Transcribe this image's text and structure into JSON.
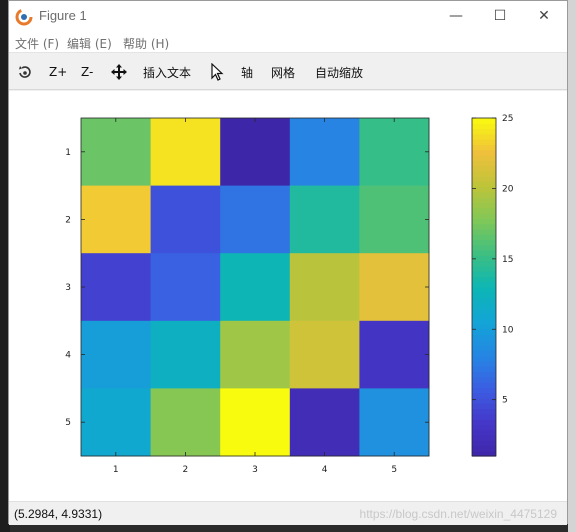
{
  "window": {
    "title": "Figure 1",
    "minimize_glyph": "—",
    "maximize_glyph": "☐",
    "close_glyph": "✕"
  },
  "menu": {
    "items": [
      {
        "label": "文件 (F)"
      },
      {
        "label": "编辑 (E)"
      },
      {
        "label": "帮助 (H)"
      }
    ]
  },
  "toolbar": {
    "zoom_in_label": "Z+",
    "zoom_out_label": "Z-",
    "insert_text_label": "插入文本",
    "axis_label": "轴",
    "grid_label": "网格",
    "auto_zoom_label": "自动缩放",
    "icons": [
      "rotate-icon",
      "pan-icon",
      "pointer-icon"
    ]
  },
  "statusbar": {
    "coordinates": "(5.2984, 4.9331)",
    "watermark": "https://blog.csdn.net/weixin_4475129"
  },
  "chart_data": {
    "type": "heatmap",
    "title": "",
    "xlabel": "",
    "ylabel": "",
    "x_categories": [
      "1",
      "2",
      "3",
      "4",
      "5"
    ],
    "y_categories": [
      "1",
      "2",
      "3",
      "4",
      "5"
    ],
    "values": [
      [
        17,
        24,
        1,
        8,
        15
      ],
      [
        23,
        5,
        7,
        14,
        16
      ],
      [
        4,
        6,
        13,
        20,
        22
      ],
      [
        10,
        12,
        19,
        21,
        3
      ],
      [
        11,
        18,
        25,
        2,
        9
      ]
    ],
    "colormap": "parula",
    "colorbar": {
      "min": 1,
      "max": 25,
      "ticks": [
        "5",
        "10",
        "15",
        "20",
        "25"
      ],
      "tick_values": [
        5,
        10,
        15,
        20,
        25
      ]
    },
    "grid": false,
    "legend": "none"
  }
}
